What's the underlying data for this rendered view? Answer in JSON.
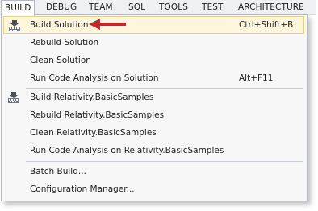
{
  "menubar": {
    "items": [
      "BUILD",
      "DEBUG",
      "TEAM",
      "SQL",
      "TOOLS",
      "TEST",
      "ARCHITECTURE"
    ]
  },
  "menu": {
    "items": [
      {
        "label": "Build Solution",
        "shortcut": "Ctrl+Shift+B",
        "icon": "build-icon"
      },
      {
        "label": "Rebuild Solution",
        "shortcut": ""
      },
      {
        "label": "Clean Solution",
        "shortcut": ""
      },
      {
        "label": "Run Code Analysis on Solution",
        "shortcut": "Alt+F11"
      },
      {
        "label": "Build Relativity.BasicSamples",
        "shortcut": "",
        "icon": "build-icon"
      },
      {
        "label": "Rebuild Relativity.BasicSamples",
        "shortcut": ""
      },
      {
        "label": "Clean Relativity.BasicSamples",
        "shortcut": ""
      },
      {
        "label": "Run Code Analysis on Relativity.BasicSamples",
        "shortcut": ""
      },
      {
        "label": "Batch Build...",
        "shortcut": ""
      },
      {
        "label": "Configuration Manager...",
        "shortcut": ""
      }
    ]
  },
  "colors": {
    "highlight_bg": "#fdf6dd",
    "highlight_border": "#e7cf84",
    "arrow": "#c0282d"
  }
}
